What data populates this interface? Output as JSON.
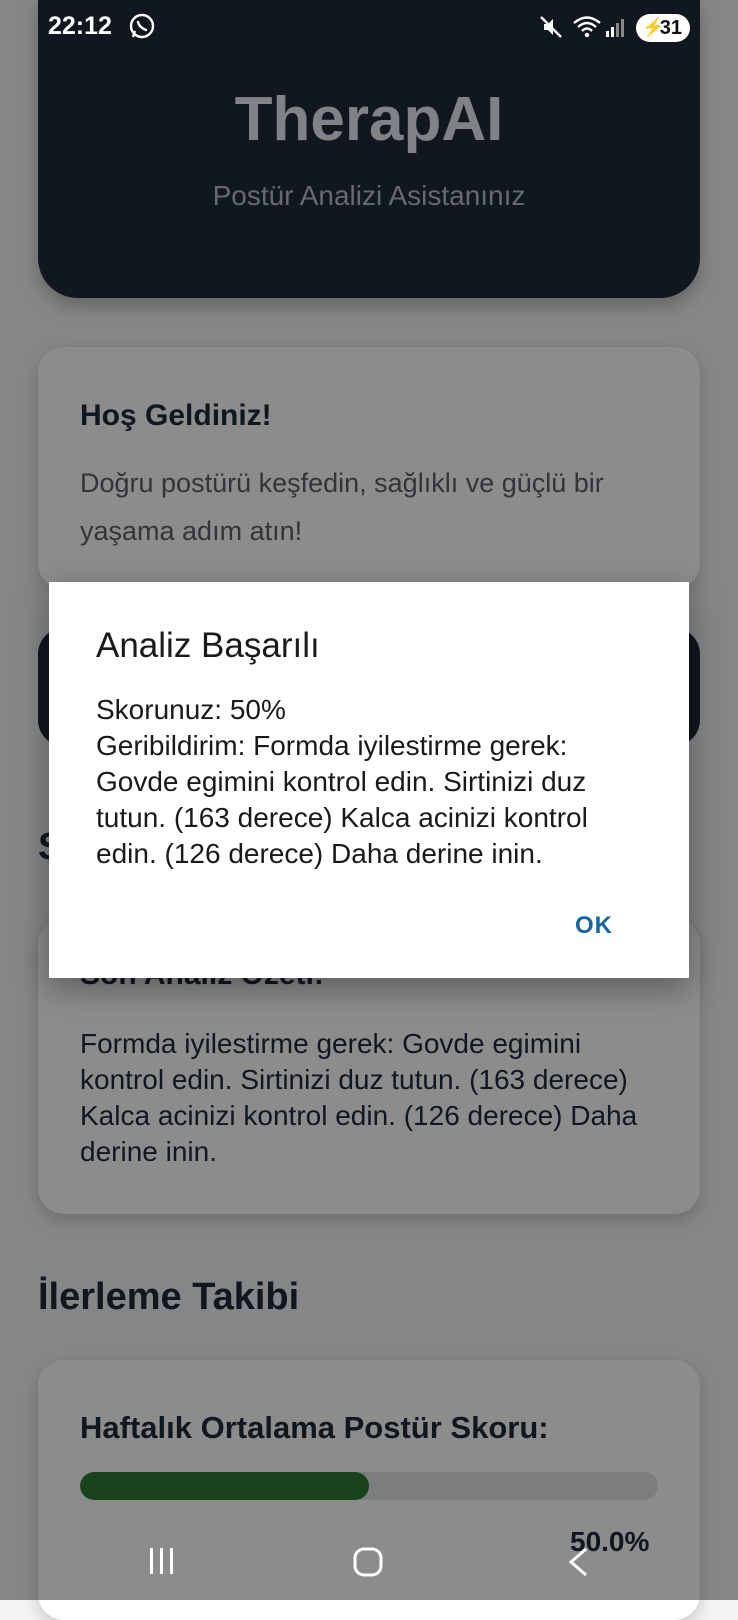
{
  "status_bar": {
    "time": "22:12",
    "battery": "31",
    "icons": [
      "whatsapp-icon",
      "mute-icon",
      "wifi-icon",
      "signal-icon",
      "battery-icon"
    ]
  },
  "header": {
    "title": "TherapAI",
    "subtitle": "Postür Analizi Asistanınız"
  },
  "welcome_card": {
    "title": "Hoş Geldiniz!",
    "text": "Doğru postürü keşfedin, sağlıklı ve güçlü bir yaşama adım atın!"
  },
  "section_partial_letter": "S",
  "summary_card": {
    "title": "Son Analiz Özeti:",
    "text": "Formda iyilestirme gerek: Govde egimini kontrol edin. Sirtinizi duz tutun. (163 derece) Kalca acinizi kontrol edin. (126 derece) Daha derine inin."
  },
  "progress": {
    "heading": "İlerleme Takibi",
    "label": "Haftalık Ortalama Postür Skoru:",
    "fraction": 0.5,
    "value_text": "50.0%"
  },
  "dialog": {
    "title": "Analiz Başarılı",
    "score_line": "Skorunuz: 50%",
    "feedback_line": "Geribildirim: Formda iyilestirme gerek: Govde egimini kontrol edin. Sirtinizi duz tutun. (163 derece) Kalca acinizi kontrol edin. (126 derece) Daha derine inin.",
    "ok_label": "OK"
  },
  "colors": {
    "header_bg": "#1f2a3a",
    "progress_fill": "#2e7d32",
    "ok_text": "#1565a0"
  }
}
